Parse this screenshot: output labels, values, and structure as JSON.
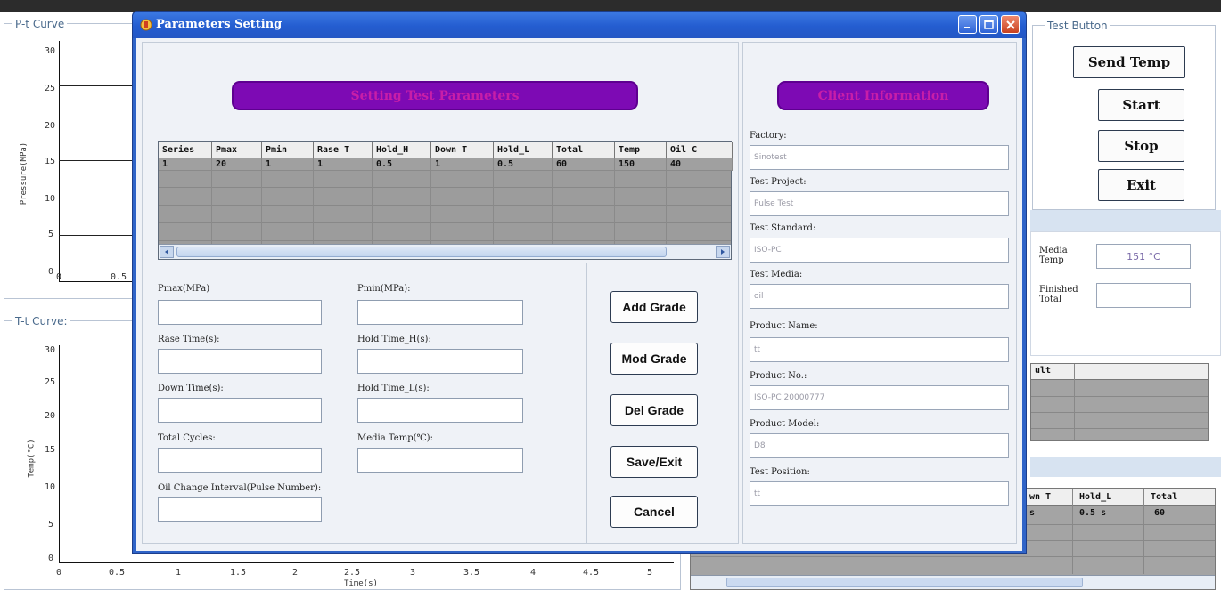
{
  "background": {
    "pt_curve": {
      "title": "P-t Curve",
      "y_ticks": [
        "30",
        "25",
        "20",
        "15",
        "10",
        "5",
        "0"
      ],
      "x_ticks": [
        "0",
        "0.5"
      ],
      "y_label": "Pressure(MPa)"
    },
    "tt_curve": {
      "title": "T-t Curve:",
      "y_ticks": [
        "30",
        "25",
        "20",
        "15",
        "10",
        "5",
        "0"
      ],
      "x_ticks": [
        "0",
        "0.5",
        "1",
        "1.5",
        "2",
        "2.5",
        "3",
        "3.5",
        "4",
        "4.5",
        "5"
      ],
      "x_label": "Time(s)",
      "y_label": "Temp(°C)"
    },
    "test_button": {
      "title": "Test Button",
      "send_temp": "Send Temp",
      "start": "Start",
      "stop": "Stop",
      "exit": "Exit"
    },
    "status": {
      "media_temp_label": "Media Temp",
      "media_temp_value": "151 °C",
      "finished_total_label": "Finished Total"
    },
    "result_header": "ult",
    "bottom_table": {
      "headers": [
        "wn T",
        "Hold_L",
        "Total"
      ],
      "row": [
        "s",
        "0.5 s",
        "60"
      ]
    }
  },
  "dialog": {
    "title": "Parameters Setting",
    "left_banner": "Setting Test Parameters",
    "right_banner": "Client Information",
    "table": {
      "headers": [
        "Series",
        "Pmax",
        "Pmin",
        "Rase T",
        "Hold_H",
        "Down T",
        "Hold_L",
        "Total",
        "Temp",
        "Oil C"
      ],
      "rows": [
        [
          "1",
          "20",
          "1",
          "1",
          "0.5",
          "1",
          "0.5",
          "60",
          "150",
          "40"
        ]
      ]
    },
    "form": {
      "pmax_label": "Pmax(MPa)",
      "pmin_label": "Pmin(MPa):",
      "rise_time_label": "Rase Time(s):",
      "hold_time_h_label": "Hold Time_H(s):",
      "down_time_label": "Down Time(s):",
      "hold_time_l_label": "Hold Time_L(s):",
      "total_cycles_label": "Total Cycles:",
      "media_temp_label": "Media Temp(℃):",
      "oil_change_label": "Oil Change Interval(Pulse Number):"
    },
    "buttons": {
      "add_grade": "Add Grade",
      "mod_grade": "Mod Grade",
      "del_grade": "Del Grade",
      "save_exit": "Save/Exit",
      "cancel": "Cancel"
    },
    "client": {
      "factory_label": "Factory:",
      "factory_value": "Sinotest",
      "test_project_label": "Test Project:",
      "test_project_value": "Pulse Test",
      "test_standard_label": "Test Standard:",
      "test_standard_value": "ISO-PC",
      "test_media_label": "Test Media:",
      "test_media_value": "oil",
      "product_name_label": "Product Name:",
      "product_name_value": "tt",
      "product_no_label": "Product No.:",
      "product_no_value": "ISO-PC 20000777",
      "product_model_label": "Product Model:",
      "product_model_value": "D8",
      "test_position_label": "Test Position:",
      "test_position_value": "tt"
    }
  }
}
